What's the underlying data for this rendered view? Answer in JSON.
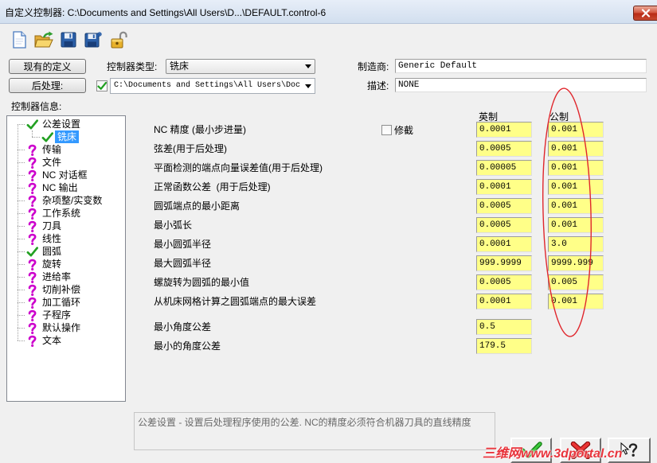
{
  "window": {
    "title": "自定义控制器: C:\\Documents and Settings\\All Users\\D...\\DEFAULT.control-6",
    "close_icon": "close-icon"
  },
  "toolbar": {
    "icons": [
      "new-file-icon",
      "open-folder-icon",
      "save-icon",
      "save-as-icon",
      "lock-icon"
    ]
  },
  "header": {
    "existing_definitions_button": "现有的定义",
    "controller_type_label": "控制器类型:",
    "controller_type_value": "铣床",
    "manufacturer_label": "制造商:",
    "manufacturer_value": "Generic Default",
    "post_button": "后处理:",
    "post_checked": true,
    "post_path": "C:\\Documents and Settings\\All Users\\Doc",
    "description_label": "描述:",
    "description_value": "NONE"
  },
  "tree": {
    "label": "控制器信息:",
    "items": [
      {
        "label": "公差设置",
        "icon": "check-icon",
        "children": [
          {
            "label": "铣床",
            "icon": "check-icon",
            "selected": true
          }
        ]
      },
      {
        "label": "传输",
        "icon": "question-icon"
      },
      {
        "label": "文件",
        "icon": "question-icon"
      },
      {
        "label": "NC 对话框",
        "icon": "question-icon"
      },
      {
        "label": "NC 输出",
        "icon": "question-icon"
      },
      {
        "label": "杂项整/实变数",
        "icon": "question-icon"
      },
      {
        "label": "工作系统",
        "icon": "question-icon"
      },
      {
        "label": "刀具",
        "icon": "question-icon"
      },
      {
        "label": "线性",
        "icon": "question-icon"
      },
      {
        "label": "圆弧",
        "icon": "check-icon"
      },
      {
        "label": "旋转",
        "icon": "question-icon"
      },
      {
        "label": "进给率",
        "icon": "question-icon"
      },
      {
        "label": "切削补偿",
        "icon": "question-icon"
      },
      {
        "label": "加工循环",
        "icon": "question-icon"
      },
      {
        "label": "子程序",
        "icon": "question-icon"
      },
      {
        "label": "默认操作",
        "icon": "question-icon"
      },
      {
        "label": "文本",
        "icon": "question-icon"
      }
    ]
  },
  "form": {
    "english_header": "英制",
    "metric_header": "公制",
    "trim_checkbox_label": "修截",
    "trim_checked": false,
    "rows": [
      {
        "label": "NC 精度 (最小步进量)",
        "english": "0.0001",
        "metric": "0.001"
      },
      {
        "label": "弦差(用于后处理)",
        "english": "0.0005",
        "metric": "0.001"
      },
      {
        "label": "平面检测的端点向量误差值(用于后处理)",
        "english": "0.00005",
        "metric": "0.001"
      },
      {
        "label": "正常函数公差  (用于后处理)",
        "english": "0.0001",
        "metric": "0.001"
      },
      {
        "label": "圆弧端点的最小距离",
        "english": "0.0005",
        "metric": "0.001"
      },
      {
        "label": "最小弧长",
        "english": "0.0005",
        "metric": "0.001"
      },
      {
        "label": "最小圆弧半径",
        "english": "0.0001",
        "metric": "3.0"
      },
      {
        "label": "最大圆弧半径",
        "english": "999.9999",
        "metric": "9999.999"
      },
      {
        "label": "螺旋转为圆弧的最小值",
        "english": "0.0005",
        "metric": "0.005"
      },
      {
        "label": "从机床网格计算之圆弧端点的最大误差",
        "english": "0.0001",
        "metric": "0.001"
      }
    ],
    "angle_rows": [
      {
        "label": "最小角度公差",
        "value": "0.5"
      },
      {
        "label": "最小的角度公差",
        "value": "179.5"
      }
    ]
  },
  "help_text": "公差设置 - 设置后处理程序使用的公差. NC的精度必须符合机器刀具的直线精度",
  "dialog_buttons": {
    "ok_icon": "ok-check-icon",
    "cancel_icon": "cancel-x-icon",
    "help_icon": "help-question-icon"
  },
  "watermark": "三维网www.3dportal.cn",
  "colors": {
    "check": "#22a022",
    "question": "#cc00cc",
    "input_fill": "#ffff88",
    "selection": "#3399ff",
    "annotation": "#e0262c",
    "watermark": "#e8343c"
  }
}
